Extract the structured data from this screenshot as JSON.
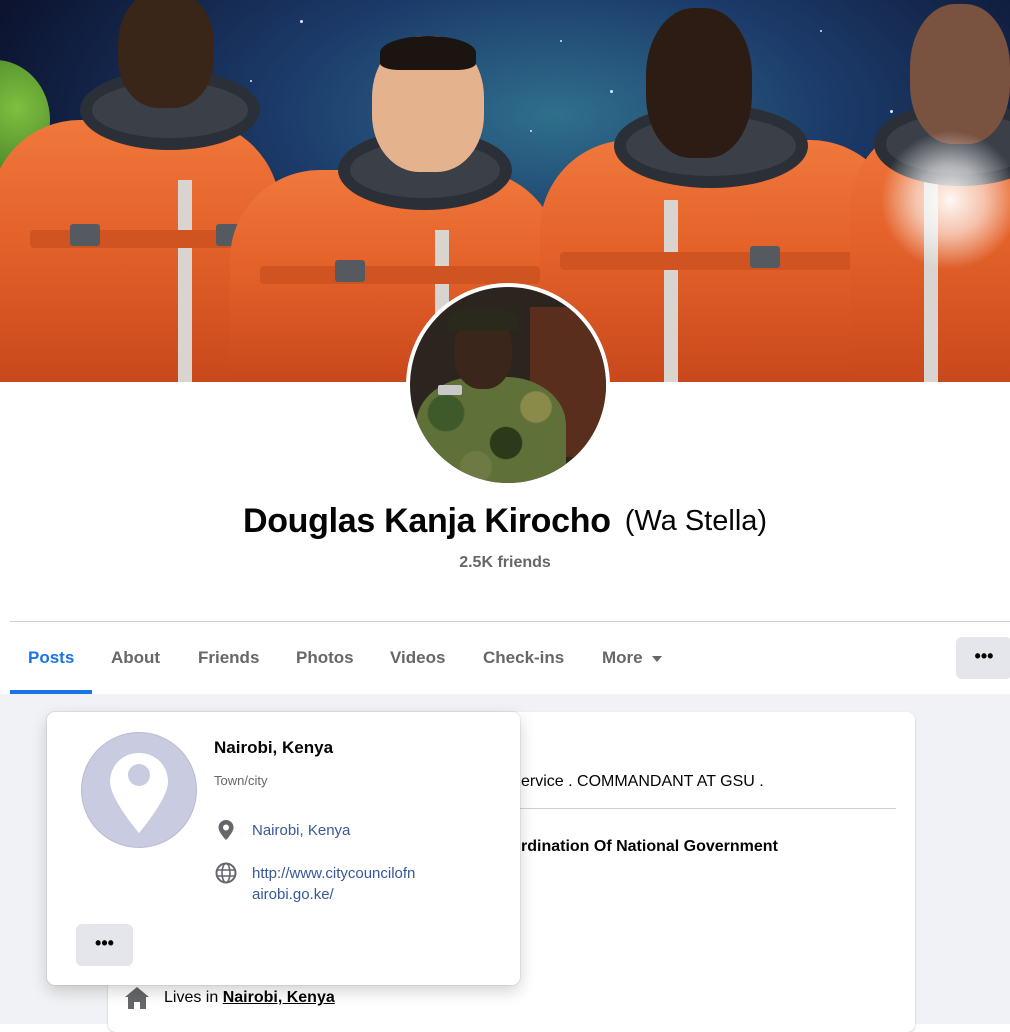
{
  "profile": {
    "name": "Douglas Kanja Kirocho",
    "alternate_name": "(Wa Stella)",
    "friends_count": "2.5K friends"
  },
  "tabs": [
    {
      "label": "Posts",
      "active": true
    },
    {
      "label": "About",
      "active": false
    },
    {
      "label": "Friends",
      "active": false
    },
    {
      "label": "Photos",
      "active": false
    },
    {
      "label": "Videos",
      "active": false
    },
    {
      "label": "Check-ins",
      "active": false
    },
    {
      "label": "More",
      "active": false
    }
  ],
  "tab_more_button": "•••",
  "intro": {
    "line1": "ervice . COMMANDANT AT GSU .",
    "line2": "rdination Of National Government",
    "lives_prefix": "Lives in ",
    "lives_link": "Nairobi, Kenya"
  },
  "hover_card": {
    "title": "Nairobi, Kenya",
    "subtitle": "Town/city",
    "location_link": "Nairobi, Kenya",
    "website_line1": "http://www.citycouncilofn",
    "website_line2": "airobi.go.ke/",
    "more_button": "•••"
  },
  "icons": {
    "location": "map-pin-icon",
    "website": "globe-icon",
    "home": "house-icon",
    "place": "map-pin-icon"
  },
  "colors": {
    "accent": "#1b74e4",
    "link": "#385898",
    "secondary_text": "#65676b",
    "button_bg": "#e4e6eb",
    "page_bg": "#f0f2f5"
  }
}
